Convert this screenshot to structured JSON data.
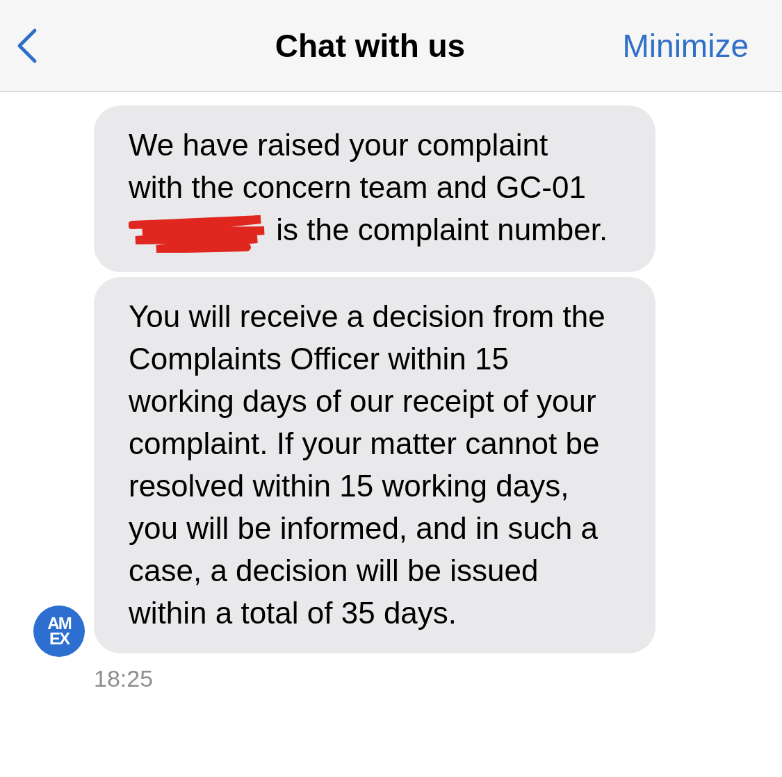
{
  "header": {
    "title": "Chat with us",
    "action": "Minimize"
  },
  "messages": [
    {
      "kind": "redacted",
      "before": "We have raised your complaint with the concern team and GC-01",
      "after": "is the complaint number."
    },
    {
      "kind": "plain",
      "text": "You will receive a decision from the Complaints Officer within 15 working days of our receipt of your complaint. If your matter cannot be resolved within 15 working days, you will be informed, and in such a case, a decision will be issued within a total of 35 days."
    }
  ],
  "avatar": {
    "line_1": "AM",
    "line_2": "EX"
  },
  "time": "18:25"
}
